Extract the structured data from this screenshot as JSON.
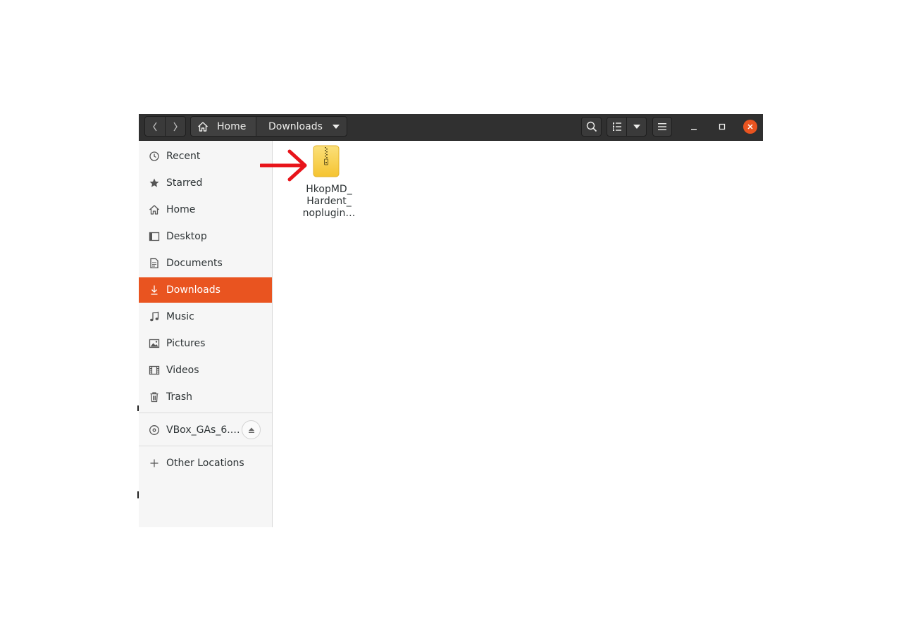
{
  "toolbar": {
    "path": [
      {
        "label": "Home",
        "icon": "home-icon"
      },
      {
        "label": "Downloads",
        "icon": "chevron-down-icon"
      }
    ],
    "buttons": [
      "back-icon",
      "forward-icon",
      "search-icon",
      "list-view-icon",
      "view-options-icon",
      "menu-icon"
    ],
    "window_controls": [
      "minimize-icon",
      "maximize-icon",
      "close-icon"
    ]
  },
  "sidebar": {
    "items": [
      {
        "label": "Recent",
        "icon": "clock-icon"
      },
      {
        "label": "Starred",
        "icon": "star-icon"
      },
      {
        "label": "Home",
        "icon": "home-icon"
      },
      {
        "label": "Desktop",
        "icon": "desktop-icon"
      },
      {
        "label": "Documents",
        "icon": "document-icon"
      },
      {
        "label": "Downloads",
        "icon": "download-icon",
        "active": true
      },
      {
        "label": "Music",
        "icon": "music-icon"
      },
      {
        "label": "Pictures",
        "icon": "picture-icon"
      },
      {
        "label": "Videos",
        "icon": "video-icon"
      },
      {
        "label": "Trash",
        "icon": "trash-icon"
      }
    ],
    "devices": [
      {
        "label": "VBox_GAs_6.…",
        "icon": "disc-icon",
        "action_icon": "eject-icon"
      }
    ],
    "other": {
      "label": "Other Locations",
      "icon": "plus-icon"
    }
  },
  "files": [
    {
      "name_lines": [
        "HkopMD_",
        "Hardent_",
        "noplugin…"
      ],
      "icon": "archive-zip-icon"
    }
  ],
  "annotation": {
    "icon": "red-arrow-icon",
    "color": "#e8141a"
  },
  "colors": {
    "accent": "#e95420",
    "titlebar": "#303030",
    "sidebar": "#f6f6f6"
  }
}
